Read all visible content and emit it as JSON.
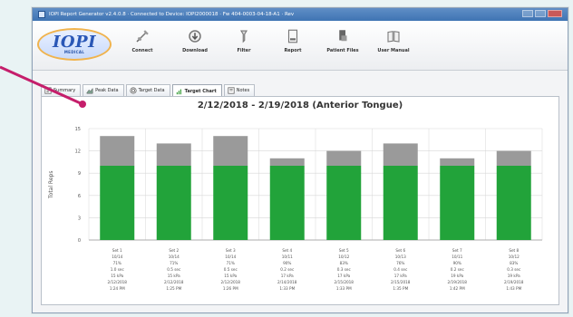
{
  "window": {
    "title": "IOPI Report Generator v2.4.0.8 · Connected to Device: IOPI2000018 · Fw 404-0003-04-18-A1 · Rev",
    "icon": "app-window-icon"
  },
  "logo": {
    "main": "IOPI",
    "sub": "MEDICAL"
  },
  "toolbar": {
    "items": [
      {
        "label": "Connect",
        "icon": "plug-icon"
      },
      {
        "label": "Download",
        "icon": "download-icon"
      },
      {
        "label": "Filter",
        "icon": "filter-icon"
      },
      {
        "label": "Report",
        "icon": "report-icon"
      },
      {
        "label": "Patient Files",
        "icon": "patient-files-icon"
      },
      {
        "label": "User Manual",
        "icon": "manual-icon"
      }
    ]
  },
  "tabs": [
    {
      "label": "Summary",
      "icon": "summary-icon"
    },
    {
      "label": "Peak Data",
      "icon": "peak-data-icon"
    },
    {
      "label": "Target Data",
      "icon": "target-data-icon"
    },
    {
      "label": "Target Chart",
      "icon": "target-chart-icon",
      "active": true
    },
    {
      "label": "Notes",
      "icon": "notes-icon"
    }
  ],
  "colors": {
    "green": "#22a33a",
    "gray": "#9a9a9a",
    "callout": "#c51e6b",
    "grid": "#d7d7d7"
  },
  "chart_data": {
    "type": "bar",
    "title": "2/12/2018 - 2/19/2018 (Anterior Tongue)",
    "ylabel": "Total Reps",
    "ylim": [
      0,
      15
    ],
    "yticks": [
      0,
      3,
      6,
      9,
      12,
      15
    ],
    "grid": true,
    "categories": [
      {
        "line1": "Set 1",
        "line2": "10/14",
        "line3": "71%",
        "line4": "1.0 sec",
        "line5": "15 kPa",
        "line6": "2/12/2018",
        "line7": "1:24 PM"
      },
      {
        "line1": "Set 2",
        "line2": "10/14",
        "line3": "71%",
        "line4": "0.5 sec",
        "line5": "15 kPa",
        "line6": "2/12/2018",
        "line7": "1:25 PM"
      },
      {
        "line1": "Set 3",
        "line2": "10/14",
        "line3": "71%",
        "line4": "0.5 sec",
        "line5": "15 kPa",
        "line6": "2/12/2018",
        "line7": "1:26 PM"
      },
      {
        "line1": "Set 4",
        "line2": "10/11",
        "line3": "90%",
        "line4": "0.2 sec",
        "line5": "17 kPa",
        "line6": "2/14/2018",
        "line7": "1:33 PM"
      },
      {
        "line1": "Set 5",
        "line2": "10/12",
        "line3": "83%",
        "line4": "0.3 sec",
        "line5": "17 kPa",
        "line6": "2/15/2018",
        "line7": "1:33 PM"
      },
      {
        "line1": "Set 6",
        "line2": "10/13",
        "line3": "76%",
        "line4": "0.4 sec",
        "line5": "17 kPa",
        "line6": "2/15/2018",
        "line7": "1:35 PM"
      },
      {
        "line1": "Set 7",
        "line2": "10/11",
        "line3": "90%",
        "line4": "0.2 sec",
        "line5": "19 kPa",
        "line6": "2/19/2018",
        "line7": "1:42 PM"
      },
      {
        "line1": "Set 8",
        "line2": "10/12",
        "line3": "83%",
        "line4": "0.3 sec",
        "line5": "19 kPa",
        "line6": "2/19/2018",
        "line7": "1:43 PM"
      }
    ],
    "series": [
      {
        "values": [
          10,
          10,
          10,
          10,
          10,
          10,
          10,
          10
        ]
      },
      {
        "values": [
          4,
          3,
          4,
          1,
          2,
          3,
          1,
          2
        ]
      }
    ]
  }
}
